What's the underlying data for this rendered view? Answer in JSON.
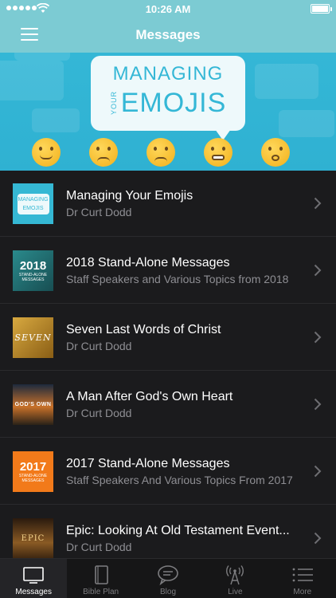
{
  "status": {
    "time": "10:26 AM"
  },
  "header": {
    "title": "Messages"
  },
  "banner": {
    "line1": "MANAGING",
    "line2_small": "YOUR",
    "line2": "EMOJIS"
  },
  "messages": [
    {
      "title": "Managing Your Emojis",
      "subtitle": "Dr Curt Dodd",
      "thumb": "MANAGING EMOJIS",
      "thumb_color": "#35b8d4"
    },
    {
      "title": "2018 Stand-Alone Messages",
      "subtitle": "Staff Speakers and Various Topics from 2018",
      "thumb": "2018",
      "thumb_sub": "STAND-ALONE MESSAGES",
      "thumb_color": "#1f6f73"
    },
    {
      "title": "Seven Last Words of Christ",
      "subtitle": "Dr Curt Dodd",
      "thumb": "SEVEN",
      "thumb_color": "#b8892a"
    },
    {
      "title": "A Man After God's Own Heart",
      "subtitle": "Dr Curt Dodd",
      "thumb": "GOD'S OWN",
      "thumb_color": "#3b4e68"
    },
    {
      "title": "2017 Stand-Alone Messages",
      "subtitle": "Staff Speakers And Various Topics From 2017",
      "thumb": "2017",
      "thumb_sub": "STAND-ALONE MESSAGES",
      "thumb_color": "#f27a1a"
    },
    {
      "title": "Epic: Looking At Old Testament Event...",
      "subtitle": "Dr Curt Dodd",
      "thumb": "EPIC",
      "thumb_color": "#5a3a1c"
    }
  ],
  "tabs": [
    {
      "label": "Messages",
      "icon": "tv-icon",
      "active": true
    },
    {
      "label": "Bible Plan",
      "icon": "book-icon",
      "active": false
    },
    {
      "label": "Blog",
      "icon": "chat-bubble-icon",
      "active": false
    },
    {
      "label": "Live",
      "icon": "broadcast-tower-icon",
      "active": false
    },
    {
      "label": "More",
      "icon": "list-icon",
      "active": false
    }
  ],
  "colors": {
    "accent": "#7ccbd3",
    "banner": "#34b7d6",
    "background": "#1b1b1d",
    "subtitle": "#8e8e93"
  }
}
